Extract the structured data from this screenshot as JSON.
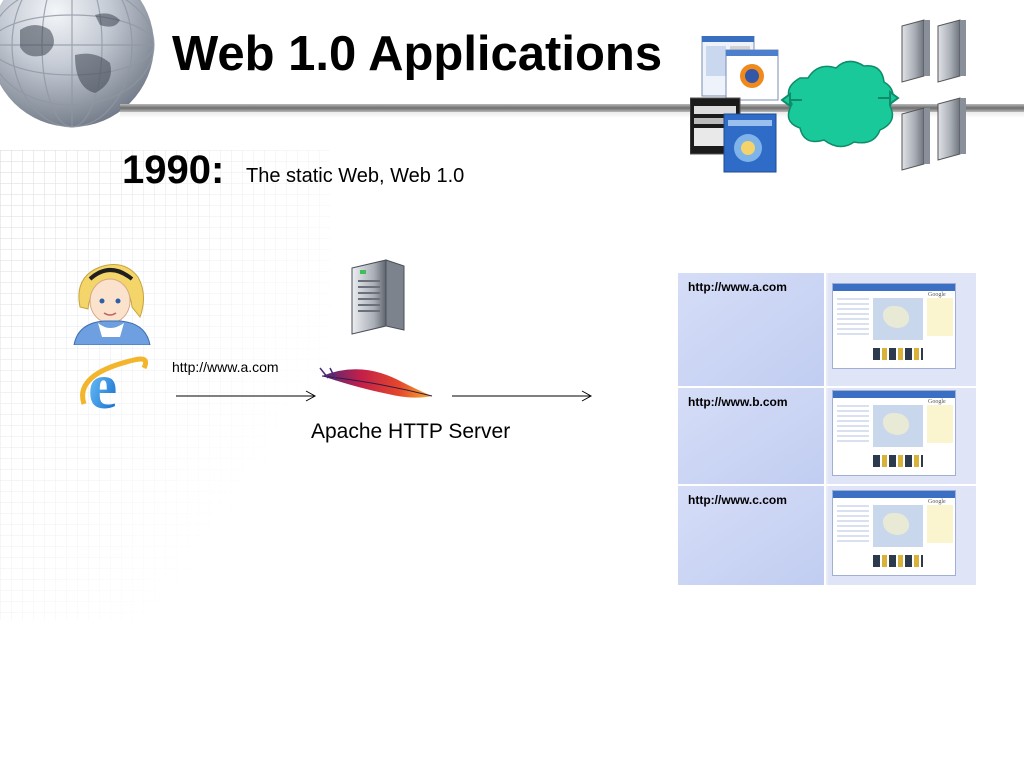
{
  "slide": {
    "title": "Web 1.0 Applications",
    "year": "1990:",
    "subtitle": "The static Web, Web 1.0"
  },
  "flow": {
    "request_url": "http://www.a.com",
    "server_label": "Apache HTTP Server"
  },
  "sites": [
    {
      "url": "http://www.a.com"
    },
    {
      "url": "http://www.b.com"
    },
    {
      "url": "http://www.c.com"
    }
  ],
  "mini_logo": "Google",
  "colors": {
    "cloud": "#19c99a",
    "table_cell": "#c9d4f3",
    "title_bar": "#7a7a7a"
  },
  "icons": [
    "globe-icon",
    "user-avatar-icon",
    "internet-explorer-icon",
    "server-icon",
    "apache-feather-icon",
    "cloud-icon",
    "browser-windows-icon"
  ]
}
